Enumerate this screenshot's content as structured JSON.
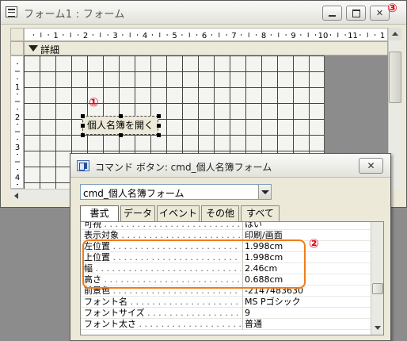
{
  "form_window": {
    "title": "フォーム1 : フォーム",
    "section_label": "詳細",
    "ruler_numbers": [
      "1",
      "2",
      "3",
      "4",
      "5",
      "6",
      "7",
      "8",
      "9",
      "10",
      "11",
      "1"
    ],
    "v_ruler_numbers": [
      "1",
      "2",
      "3",
      "4"
    ],
    "command_button_label": "個人名簿を開く"
  },
  "callouts": {
    "one": "①",
    "two": "②",
    "three": "③"
  },
  "property_sheet": {
    "title": "コマンド ボタン: cmd_個人名簿フォーム",
    "close_glyph": "✕",
    "selected_object": "cmd_個人名簿フォーム",
    "tabs": [
      "書式",
      "データ",
      "イベント",
      "その他",
      "すべて"
    ],
    "active_tab": "書式",
    "properties": [
      {
        "name": "可視",
        "value": "はい"
      },
      {
        "name": "表示対象",
        "value": "印刷/画面"
      },
      {
        "name": "左位置",
        "value": "1.998cm"
      },
      {
        "name": "上位置",
        "value": "1.998cm"
      },
      {
        "name": "幅",
        "value": "2.46cm"
      },
      {
        "name": "高さ",
        "value": "0.688cm"
      },
      {
        "name": "前景色",
        "value": "-2147483630"
      },
      {
        "name": "フォント名",
        "value": "MS Pゴシック"
      },
      {
        "name": "フォントサイズ",
        "value": "9"
      },
      {
        "name": "フォント太さ",
        "value": "普通"
      }
    ]
  },
  "colors": {
    "highlight": "#f07d19",
    "callout": "#e60012"
  },
  "icons": [
    "form-icon",
    "minimize-icon",
    "maximize-icon",
    "close-icon",
    "property-sheet-icon",
    "dropdown-arrow-icon",
    "section-arrow-icon"
  ]
}
